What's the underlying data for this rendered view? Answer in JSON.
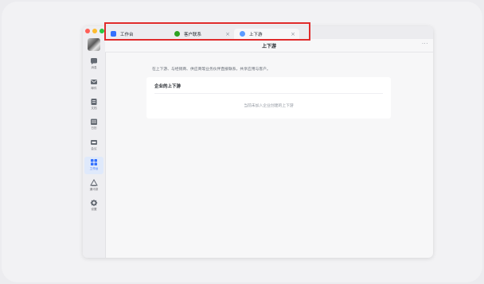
{
  "colors": {
    "accent": "#3370ff",
    "highlight": "#e02b2b",
    "traffic_close": "#ff5f57",
    "traffic_min": "#febc2e",
    "traffic_max": "#28c840"
  },
  "sidebar": {
    "items": [
      {
        "label": "消息",
        "icon": "chat-icon"
      },
      {
        "label": "邮件",
        "icon": "mail-icon"
      },
      {
        "label": "文档",
        "icon": "docs-icon"
      },
      {
        "label": "日历",
        "icon": "calendar-icon"
      },
      {
        "label": "会议",
        "icon": "video-icon"
      },
      {
        "label": "工作台",
        "icon": "workplace-grid-icon",
        "active": true
      },
      {
        "label": "通讯录",
        "icon": "contacts-icon"
      },
      {
        "label": "设置",
        "icon": "settings-gear-icon"
      }
    ]
  },
  "tabs": [
    {
      "label": "工作台",
      "icon": "workplace-tab-icon",
      "color": "#3370ff"
    },
    {
      "label": "客户联系",
      "icon": "customer-contact-tab-icon",
      "color": "#2ea121"
    },
    {
      "label": "上下游",
      "icon": "upstream-downstream-tab-icon",
      "color": "#5b9bff",
      "active": true
    }
  ],
  "header": {
    "title": "上下游",
    "more": "···"
  },
  "main": {
    "description": "在上下游、与经销商、供应商等业务伙伴直接联系，共享应用与客户。",
    "card_title": "企业的上下游",
    "empty_text": "当前未加入企业创建的上下游"
  }
}
